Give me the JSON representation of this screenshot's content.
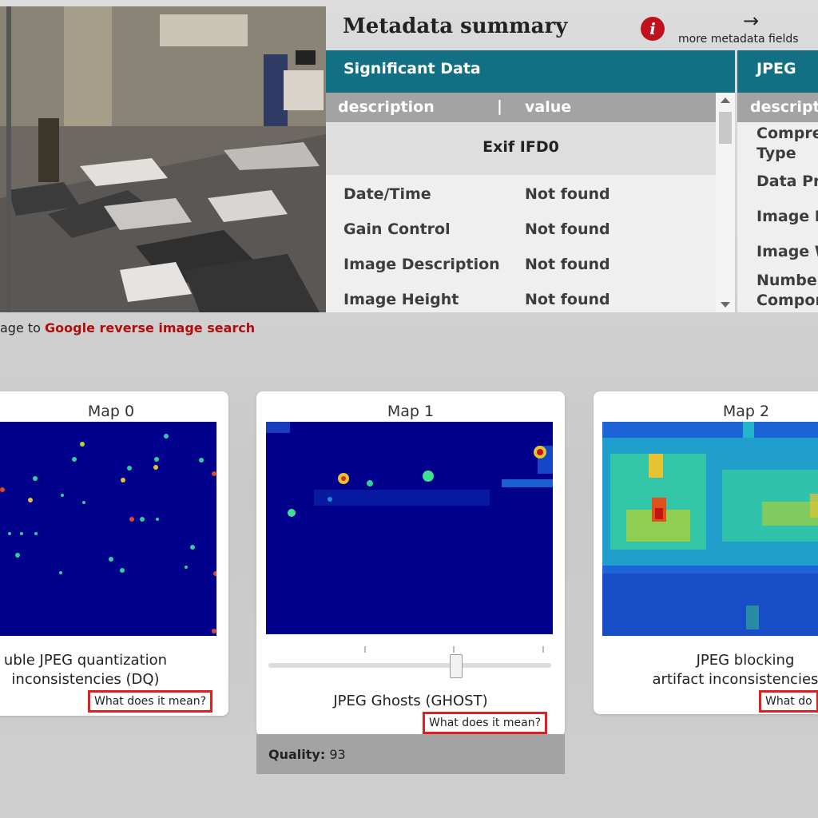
{
  "photo": {
    "description_icon": "airport-image"
  },
  "reverse_search": {
    "prefix": "age to ",
    "link": "Google reverse image search"
  },
  "metadata": {
    "title": "Metadata summary",
    "info_icon": "i",
    "arrow": "→",
    "more_fields": "more metadata fields",
    "significant": {
      "header": "Significant Data",
      "col_description": "description",
      "col_separator": "|",
      "col_value": "value",
      "group": "Exif IFD0",
      "rows": [
        {
          "description": "Date/Time",
          "value": "Not found"
        },
        {
          "description": "Gain Control",
          "value": "Not found"
        },
        {
          "description": "Image Description",
          "value": "Not found"
        },
        {
          "description": "Image Height",
          "value": "Not found"
        }
      ]
    },
    "jpeg": {
      "header": "JPEG",
      "col_description": "descript",
      "rows": [
        "Compre",
        "Type",
        "Data Pr",
        "Image H",
        "Image W",
        "Number",
        "Compor"
      ]
    }
  },
  "maps": [
    {
      "title": "Map 0",
      "caption_line1": "uble JPEG quantization",
      "caption_line2": "inconsistencies (DQ)",
      "help": "What does it mean?"
    },
    {
      "title": "Map 1",
      "caption_line1": "JPEG Ghosts (GHOST)",
      "help": "What does it mean?",
      "quality_label": "Quality:",
      "quality_value": "93",
      "slider_value": 0.66
    },
    {
      "title": "Map 2",
      "caption_line1": "JPEG blocking",
      "caption_line2": "artifact inconsistencies (B",
      "help": "What do"
    }
  ],
  "colors": {
    "teal_header": "#136f84",
    "link_red": "#b00d0d",
    "help_border": "#e02020",
    "heatmap_bg": "#00008c"
  }
}
